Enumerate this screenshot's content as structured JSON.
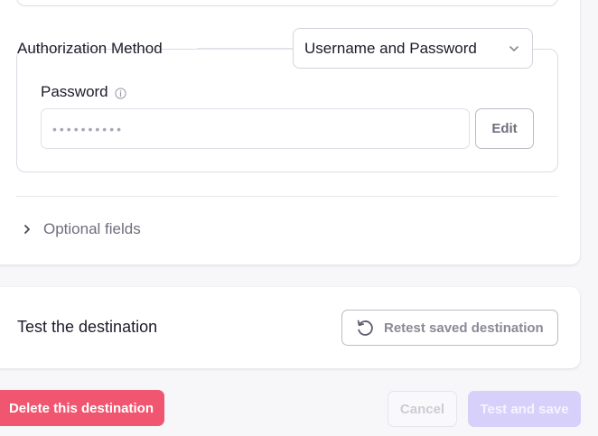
{
  "auth": {
    "label": "Authorization Method",
    "selected_method": "Username and Password",
    "password": {
      "label": "Password",
      "value": "••••••••••",
      "edit_label": "Edit"
    }
  },
  "optional": {
    "label": "Optional fields"
  },
  "test": {
    "title": "Test the destination",
    "retest_label": "Retest saved destination"
  },
  "footer": {
    "delete_label": "Delete this destination",
    "cancel_label": "Cancel",
    "save_label": "Test and save"
  },
  "colors": {
    "danger": "#f0566f",
    "primary_disabled": "#d6d0fb",
    "text_primary": "#1c1b2b",
    "text_muted": "#6f6e7d",
    "border": "#dcdbe3"
  },
  "icons": [
    "chevron-down-icon",
    "info-icon",
    "chevron-right-icon",
    "refresh-icon"
  ]
}
